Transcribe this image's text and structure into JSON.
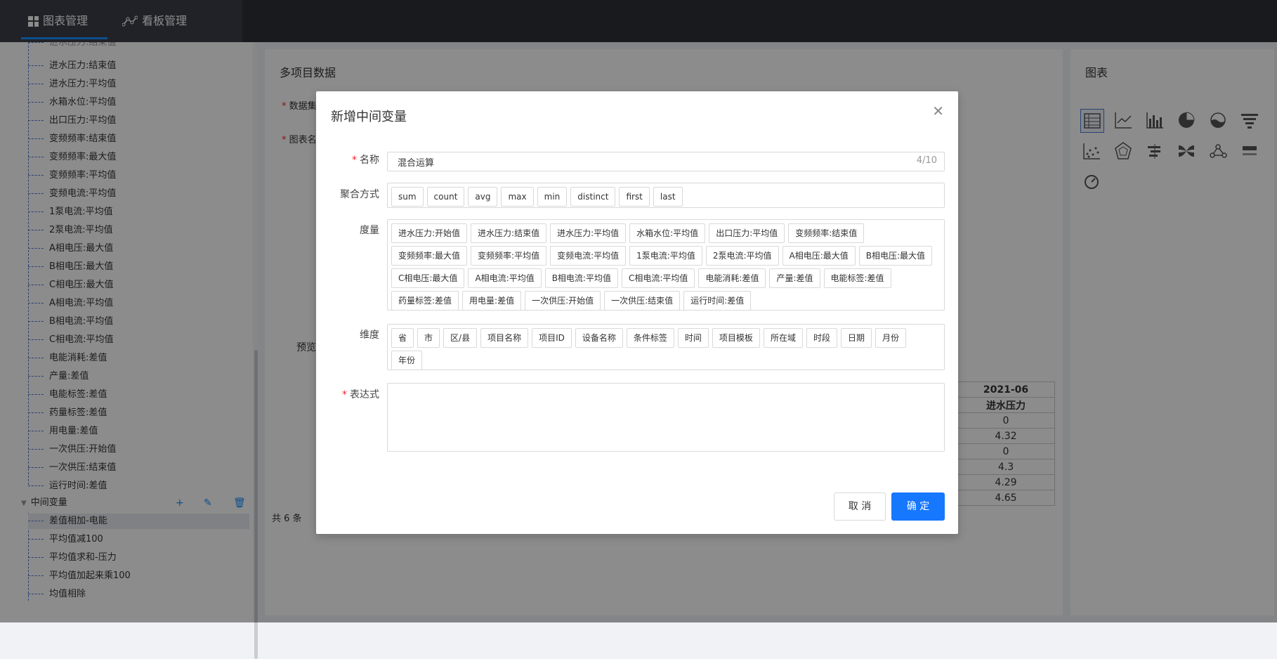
{
  "topbar": {
    "tabs": [
      {
        "label": "图表管理",
        "active": true
      },
      {
        "label": "看板管理",
        "active": false
      }
    ]
  },
  "tree": {
    "cut_item": "进水压力:结束值",
    "items": [
      "进水压力:结束值",
      "进水压力:平均值",
      "水箱水位:平均值",
      "出口压力:平均值",
      "变频频率:结束值",
      "变频频率:最大值",
      "变频频率:平均值",
      "变频电流:平均值",
      "1泵电流:平均值",
      "2泵电流:平均值",
      "A相电压:最大值",
      "B相电压:最大值",
      "C相电压:最大值",
      "A相电流:平均值",
      "B相电流:平均值",
      "C相电流:平均值",
      "电能消耗:差值",
      "产量:差值",
      "电能标签:差值",
      "药量标签:差值",
      "用电量:差值",
      "一次供压:开始值",
      "一次供压:结束值",
      "运行时间:差值"
    ],
    "group_label": "中间变量",
    "group_items": [
      "差值相加-电能",
      "平均值减100",
      "平均值求和-压力",
      "平均值加起来乘100",
      "均值相除"
    ]
  },
  "mid": {
    "title": "多项目数据",
    "field1": "数据集",
    "field2": "图表名",
    "preview": "预览",
    "total": "共 6 条",
    "table_header": "2021-06",
    "table_subheader": "进水压力",
    "table_values": [
      "0",
      "4.32",
      "0",
      "4.3",
      "4.29",
      "4.65"
    ]
  },
  "right": {
    "title": "图表"
  },
  "modal": {
    "title": "新增中间变量",
    "name_label": "名称",
    "name_value": "混合运算",
    "name_count": "4/10",
    "agg_label": "聚合方式",
    "agg": [
      "sum",
      "count",
      "avg",
      "max",
      "min",
      "distinct",
      "first",
      "last"
    ],
    "measure_label": "度量",
    "measures": [
      "进水压力:开始值",
      "进水压力:结束值",
      "进水压力:平均值",
      "水箱水位:平均值",
      "出口压力:平均值",
      "变频频率:结束值",
      "变频频率:最大值",
      "变频频率:平均值",
      "变频电流:平均值",
      "1泵电流:平均值",
      "2泵电流:平均值",
      "A相电压:最大值",
      "B相电压:最大值",
      "C相电压:最大值",
      "A相电流:平均值",
      "B相电流:平均值",
      "C相电流:平均值",
      "电能消耗:差值",
      "产量:差值",
      "电能标签:差值",
      "药量标签:差值",
      "用电量:差值",
      "一次供压:开始值",
      "一次供压:结束值",
      "运行时间:差值"
    ],
    "dim_label": "维度",
    "dims": [
      "省",
      "市",
      "区/县",
      "项目名称",
      "项目ID",
      "设备名称",
      "条件标签",
      "时间",
      "项目模板",
      "所在域",
      "时段",
      "日期",
      "月份",
      "年份"
    ],
    "expr_label": "表达式",
    "cancel": "取 消",
    "ok": "确 定"
  }
}
